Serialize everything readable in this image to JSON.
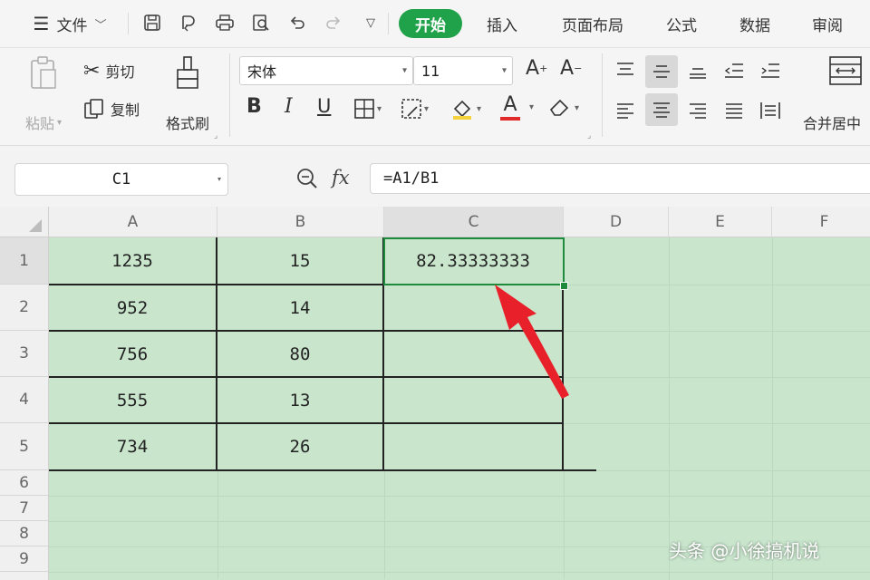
{
  "menubar": {
    "file_label": "文件",
    "tabs": [
      {
        "label": "开始",
        "active": true
      },
      {
        "label": "插入",
        "active": false
      },
      {
        "label": "页面布局",
        "active": false
      },
      {
        "label": "公式",
        "active": false
      },
      {
        "label": "数据",
        "active": false
      },
      {
        "label": "审阅",
        "active": false
      }
    ],
    "active_tab_color": "#20a24a"
  },
  "ribbon": {
    "paste_label": "粘贴",
    "cut_label": "剪切",
    "copy_label": "复制",
    "format_painter_label": "格式刷",
    "font_name": "宋体",
    "font_size": "11",
    "merge_label": "合并居中"
  },
  "formula_bar": {
    "cell_ref": "C1",
    "fx_label": "fx",
    "formula": "=A1/B1"
  },
  "grid": {
    "columns": [
      "A",
      "B",
      "C",
      "D",
      "E",
      "F"
    ],
    "rows": [
      "1",
      "2",
      "3",
      "4",
      "5",
      "6",
      "7",
      "8",
      "9"
    ],
    "cells": {
      "A": [
        "1235",
        "952",
        "756",
        "555",
        "734"
      ],
      "B": [
        "15",
        "14",
        "80",
        "13",
        "26"
      ],
      "C1": "82.33333333"
    },
    "sheet_bg_color": "#c9e6cd",
    "selection_color": "#1e8a3c",
    "arrow_color": "#e8202a"
  },
  "watermark": "头条 @小徐搞机说"
}
